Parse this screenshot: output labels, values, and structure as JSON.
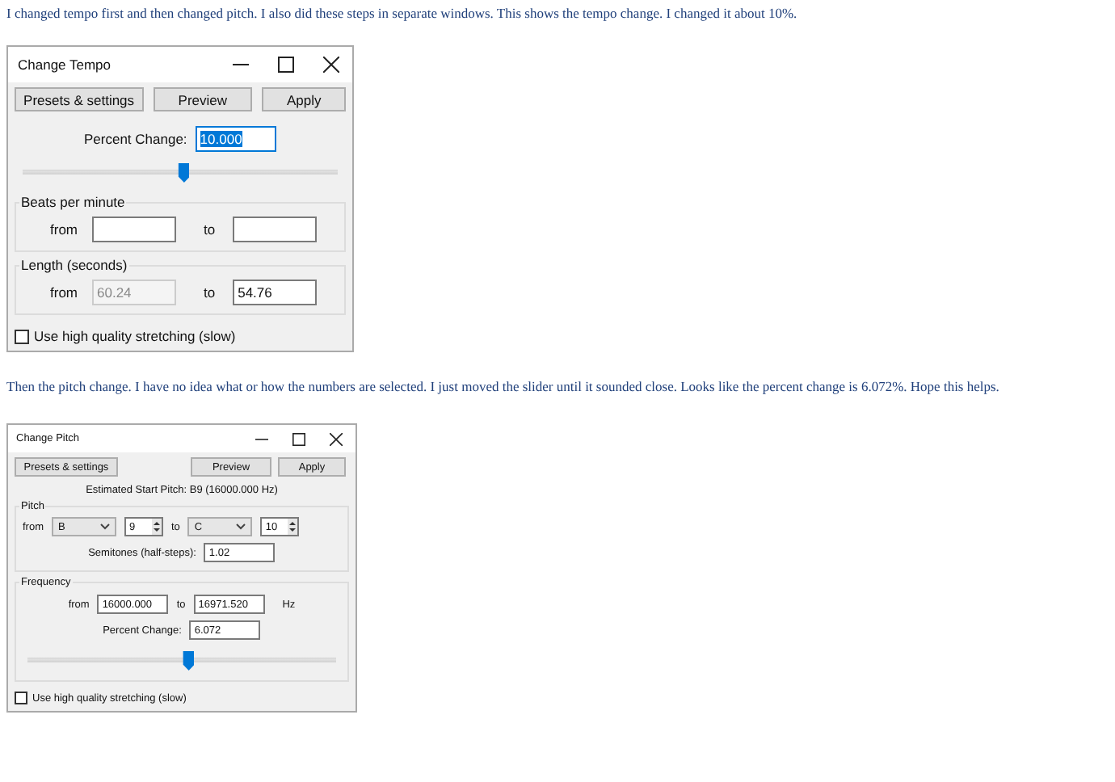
{
  "intro": "I changed tempo first and then changed pitch. I also did these steps in separate windows. This shows the tempo change. I changed it about 10%.",
  "tempo_dialog": {
    "title": "Change Tempo",
    "buttons": [
      "Presets & settings",
      "Preview",
      "Apply"
    ],
    "percent_change": {
      "label": "Percent Change:",
      "value": "10.000",
      "selected": true
    },
    "slider": {
      "level": 0.51
    },
    "beats_per_minute": {
      "title": "Beats per minute",
      "from_label": "from",
      "to_label": "to"
    },
    "length": {
      "title": "Length (seconds)",
      "from_label": "from",
      "from_value": "60.24",
      "from_disabled": true,
      "to_label": "to",
      "to_value": "54.76"
    },
    "checkbox": {
      "label": "Use high quality stretching (slow)",
      "checked": false
    }
  },
  "pitch_intro": "Then the pitch change. I have no idea what or how the numbers are selected. I just moved the slider until it sounded close. Looks like the percent change is 6.072%. Hope this helps.",
  "pitch_dialog": {
    "title": "Change Pitch",
    "buttons": [
      "Presets & settings",
      "Preview",
      "Apply"
    ],
    "estimated_start": "Estimated Start Pitch: B9 (16000.000 Hz)",
    "pitch": {
      "title": "Pitch",
      "from_label": "from",
      "from_note": "B",
      "from_octave": "9",
      "to_label": "to",
      "to_note": "C",
      "to_octave": "10",
      "semitones_label": "Semitones (half-steps):",
      "semitones_value": "1.02"
    },
    "frequency": {
      "title": "Frequency",
      "from_label": "from",
      "from_value": "16000.000",
      "to_label": "to",
      "to_value": "16971.520",
      "unit": "Hz",
      "percent_label": "Percent Change:",
      "percent_value": "6.072",
      "slider": {
        "level": 0.52
      }
    },
    "checkbox": {
      "label": "Use high quality stretching (slow)",
      "checked": false
    }
  }
}
